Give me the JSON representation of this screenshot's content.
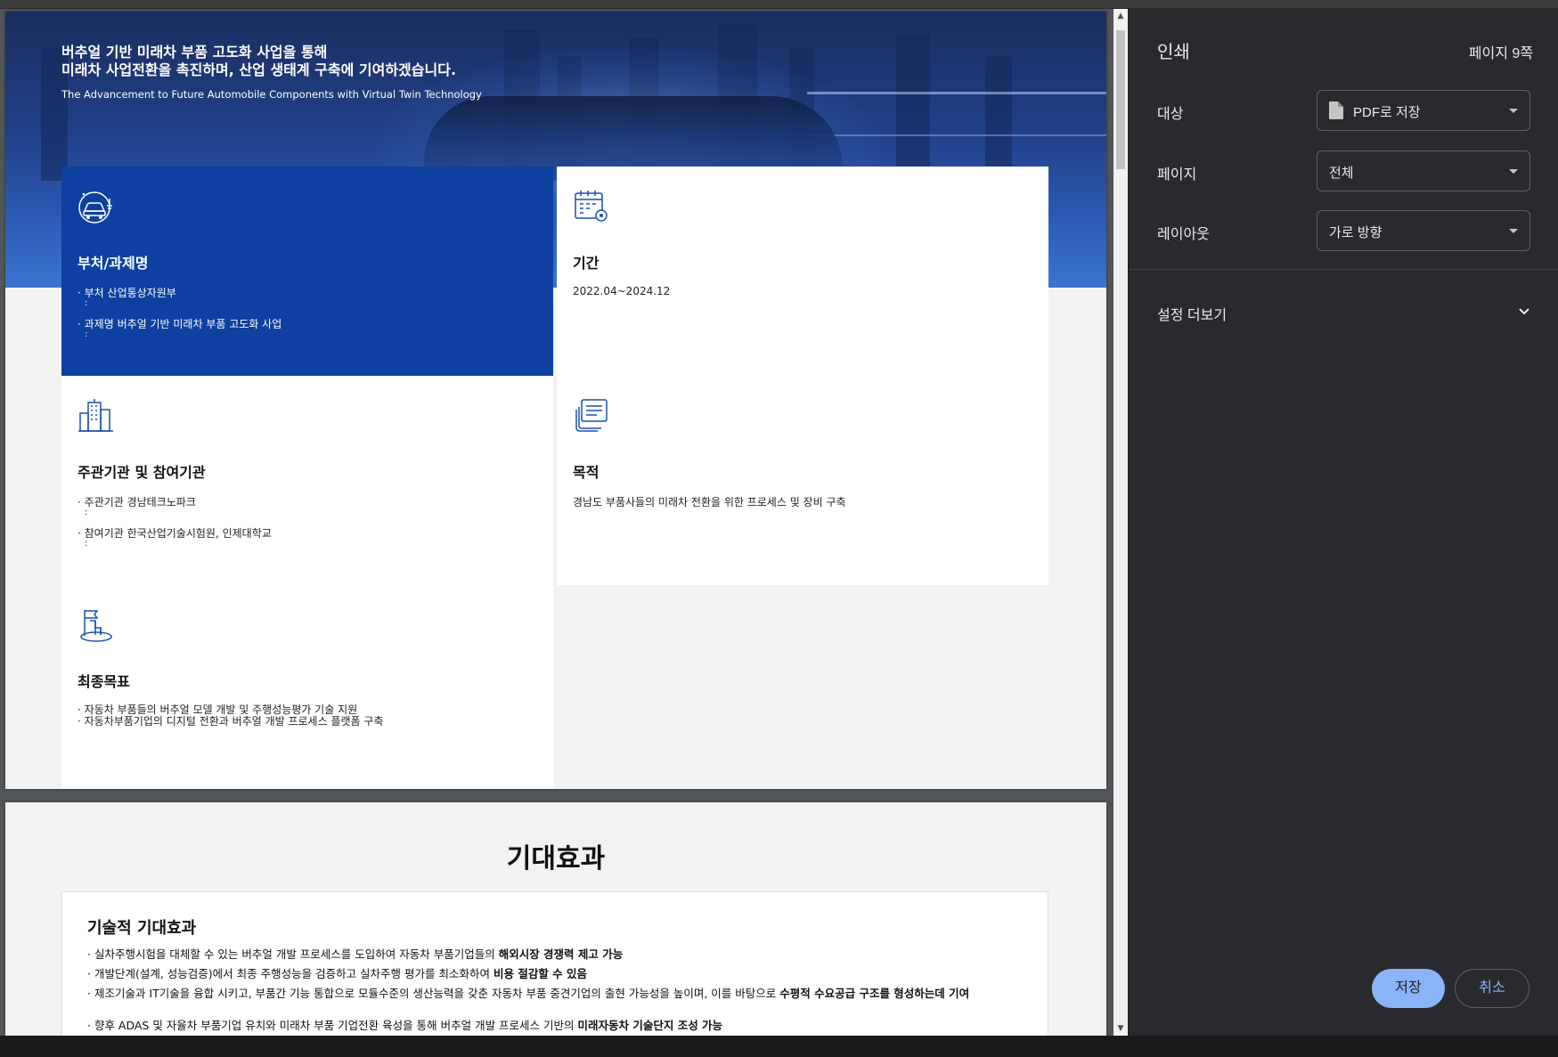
{
  "document": {
    "hero": {
      "title_line1": "버추얼 기반 미래차 부품 고도화 사업을 통해",
      "title_line2": "미래차 사업전환을 촉진하며, 산업 생태계 구축에 기여하겠습니다.",
      "subtitle": "The Advancement to Future Automobile Components with Virtual Twin Technology"
    },
    "cards": {
      "ministry": {
        "icon": "car-icon",
        "title": "부처/과제명",
        "line1": "· 부처  산업통상자원부",
        "line2": "· 과제명 버추얼 기반 미래차 부품 고도화 사업"
      },
      "period": {
        "icon": "calendar-gear-icon",
        "title": "기간",
        "value": "2022.04~2024.12"
      },
      "organizations": {
        "icon": "buildings-icon",
        "title": "주관기관 및 참여기관",
        "line1": "· 주관기관 경남테크노파크",
        "line2": "· 참여기관 한국산업기술시험원, 인제대학교"
      },
      "purpose": {
        "icon": "documents-icon",
        "title": "목적",
        "value": "경남도 부품사들의 미래차 전환을 위한 프로세스 및 장비 구축"
      },
      "goal": {
        "icon": "flag-goal-icon",
        "title": "최종목표",
        "line1": "· 자동차 부품들의 버추얼 모델 개발 및 주행성능평가 기술 지원",
        "line2": "· 자동차부품기업의 디지털 전환과 버추얼 개발 프로세스 플랫폼 구축"
      }
    },
    "page2": {
      "title": "기대효과",
      "section_title": "기술적 기대효과",
      "bullets": [
        {
          "text": "· 실차주행시험을 대체할 수 있는 버추얼 개발 프로세스를 도입하여 자동차 부품기업들의 ",
          "bold": "해외시장 경쟁력 제고 가능"
        },
        {
          "text": "· 개발단계(설계, 성능검증)에서 최종 주행성능을 검증하고 실차주행 평가를 최소화하여 ",
          "bold": "비용 절감할 수 있음"
        },
        {
          "text": "· 제조기술과 IT기술을 융합 시키고, 부품간 기능 통합으로 모듈수준의 생산능력을 갖춘 자동차 부품 중견기업의 출현 가능성을 높이며, 이를 바탕으로 ",
          "bold": "수평적 수요공급 구조를 형성하는데 기여"
        },
        {
          "text": "· 향후 ADAS 및 자율차 부품기업 유치와 미래차 부품 기업전환 육성을 통해 버추얼 개발 프로세스 기반의 ",
          "bold": "미래자동차 기술단지 조성 가능"
        }
      ]
    }
  },
  "print_panel": {
    "title": "인쇄",
    "page_count": "페이지 9쪽",
    "destination_label": "대상",
    "destination_value": "PDF로 저장",
    "pages_label": "페이지",
    "pages_value": "전체",
    "layout_label": "레이아웃",
    "layout_value": "가로 방향",
    "more_settings": "설정 더보기",
    "save_button": "저장",
    "cancel_button": "취소"
  },
  "colors": {
    "accent_blue": "#0d40a0",
    "panel_bg": "#292a2d",
    "save_button": "#8ab4f8"
  }
}
